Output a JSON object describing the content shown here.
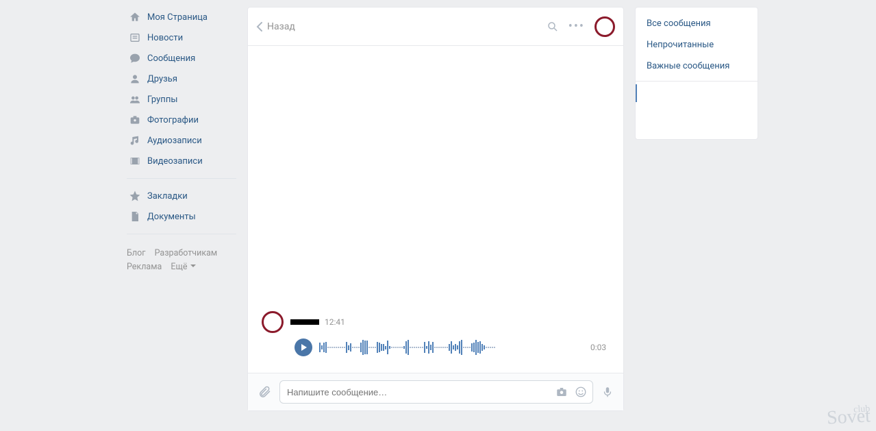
{
  "sidebar": {
    "items": [
      {
        "label": "Моя Страница",
        "icon": "home-icon"
      },
      {
        "label": "Новости",
        "icon": "news-icon"
      },
      {
        "label": "Сообщения",
        "icon": "messages-icon"
      },
      {
        "label": "Друзья",
        "icon": "friends-icon"
      },
      {
        "label": "Группы",
        "icon": "groups-icon"
      },
      {
        "label": "Фотографии",
        "icon": "camera-icon"
      },
      {
        "label": "Аудиозаписи",
        "icon": "music-icon"
      },
      {
        "label": "Видеозаписи",
        "icon": "video-icon"
      }
    ],
    "secondary": [
      {
        "label": "Закладки",
        "icon": "star-icon"
      },
      {
        "label": "Документы",
        "icon": "document-icon"
      }
    ]
  },
  "footer": {
    "blog": "Блог",
    "developers": "Разработчикам",
    "ads": "Реклама",
    "more": "Ещё"
  },
  "chat": {
    "back_label": "Назад",
    "title": "",
    "message": {
      "time": "12:41",
      "voice_duration": "0:03"
    }
  },
  "composer": {
    "placeholder": "Напишите сообщение…"
  },
  "filters": {
    "all": "Все сообщения",
    "unread": "Непрочитанные",
    "important": "Важные сообщения"
  },
  "watermark": {
    "line1": "club",
    "line2": "Sovet"
  }
}
